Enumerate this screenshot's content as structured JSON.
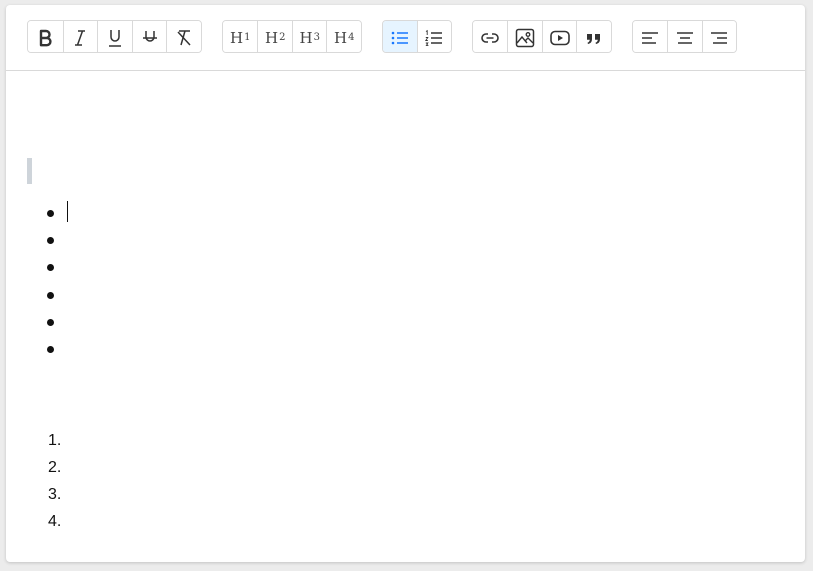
{
  "toolbar": {
    "format_group": [
      {
        "name": "bold",
        "icon": "bold-icon"
      },
      {
        "name": "italic",
        "icon": "italic-icon"
      },
      {
        "name": "underline",
        "icon": "underline-icon"
      },
      {
        "name": "strikethrough",
        "icon": "strikethrough-icon"
      },
      {
        "name": "clear-format",
        "icon": "clear-format-icon"
      }
    ],
    "heading_group": [
      {
        "label": "H",
        "level": "1"
      },
      {
        "label": "H",
        "level": "2"
      },
      {
        "label": "H",
        "level": "3"
      },
      {
        "label": "H",
        "level": "4"
      }
    ],
    "list_group": [
      {
        "name": "bullet-list",
        "icon": "bullet-list-icon",
        "active": true
      },
      {
        "name": "ordered-list",
        "icon": "ordered-list-icon",
        "active": false
      }
    ],
    "insert_group": [
      {
        "name": "link",
        "icon": "link-icon"
      },
      {
        "name": "image",
        "icon": "image-icon"
      },
      {
        "name": "video",
        "icon": "video-icon"
      },
      {
        "name": "blockquote",
        "icon": "quote-icon"
      }
    ],
    "align_group": [
      {
        "name": "align-left",
        "icon": "align-left-icon"
      },
      {
        "name": "align-center",
        "icon": "align-center-icon"
      },
      {
        "name": "align-right",
        "icon": "align-right-icon"
      }
    ],
    "active_color": "#1677ff",
    "active_bg": "#e6f4ff"
  },
  "content": {
    "bullet_items": 6,
    "ordered_items": [
      "1.",
      "2.",
      "3.",
      "4."
    ]
  }
}
